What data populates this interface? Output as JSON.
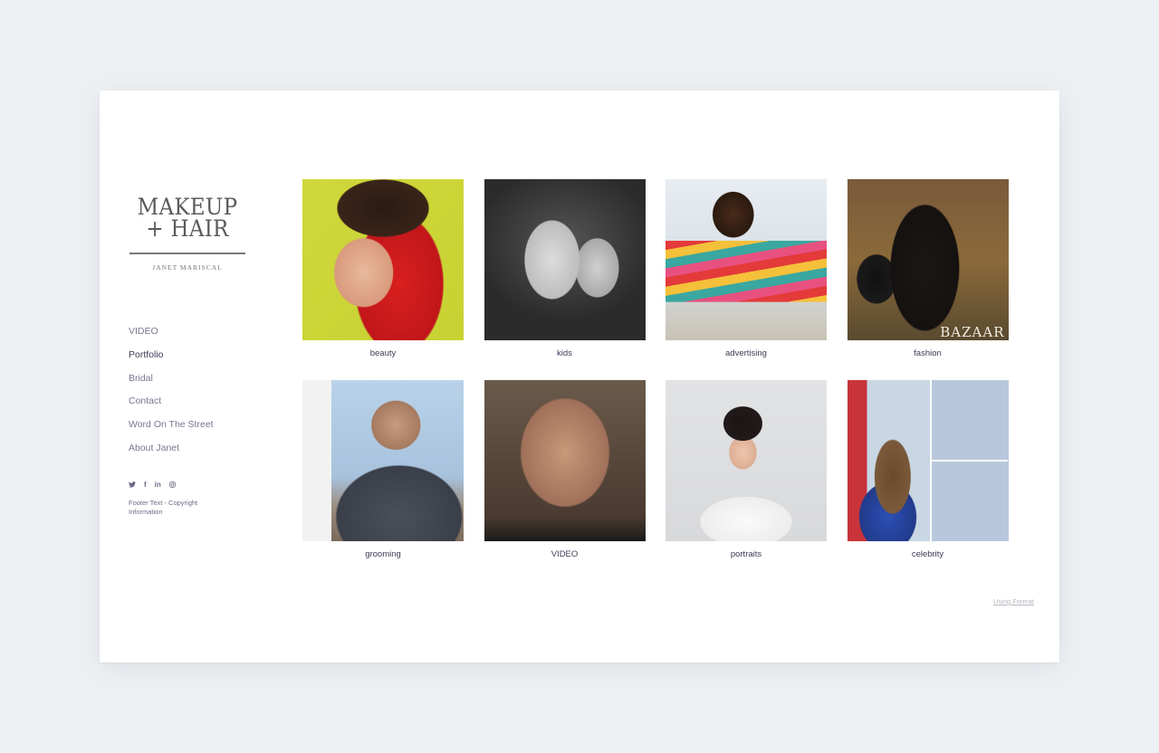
{
  "logo": {
    "title_line1": "MAKEUP",
    "title_line2": "+ HAIR",
    "subtitle": "JANET MARISCAL"
  },
  "nav": {
    "items": [
      {
        "label": "VIDEO",
        "active": false
      },
      {
        "label": "Portfolio",
        "active": true
      },
      {
        "label": "Bridal",
        "active": false
      },
      {
        "label": "Contact",
        "active": false
      },
      {
        "label": "Word On The Street",
        "active": false
      },
      {
        "label": "About Janet",
        "active": false
      }
    ]
  },
  "social": {
    "icons": [
      "twitter-icon",
      "facebook-icon",
      "linkedin-icon",
      "instagram-icon"
    ],
    "facebook_glyph": "f",
    "linkedin_glyph": "in"
  },
  "footer": {
    "text": "Footer Text - Copyright Information",
    "using_format": "Using Format"
  },
  "gallery": {
    "tiles": [
      {
        "caption": "beauty",
        "image": "curly-haired woman in red hood with yellow eyeliner"
      },
      {
        "caption": "kids",
        "image": "black-and-white portrait of girl covering eye with hand"
      },
      {
        "caption": "advertising",
        "image": "smiling woman in striped rainbow sweater"
      },
      {
        "caption": "fashion",
        "image": "woman in black top and jeans, Bazaar cover"
      },
      {
        "caption": "grooming",
        "image": "man in suit and sunglasses, magazine page"
      },
      {
        "caption": "VIDEO",
        "image": "close-up portrait of man"
      },
      {
        "caption": "portraits",
        "image": "woman with bangs and top knot in white top"
      },
      {
        "caption": "celebrity",
        "image": "collage of actress on red carpet in blue dress"
      }
    ],
    "fashion_overlay_text": "BAZAAR"
  },
  "colors": {
    "page_bg": "#eef1f4",
    "card_bg": "#ffffff",
    "nav_text": "#7a7690",
    "nav_active": "#3d3a55",
    "caption_text": "#3d3a55"
  }
}
